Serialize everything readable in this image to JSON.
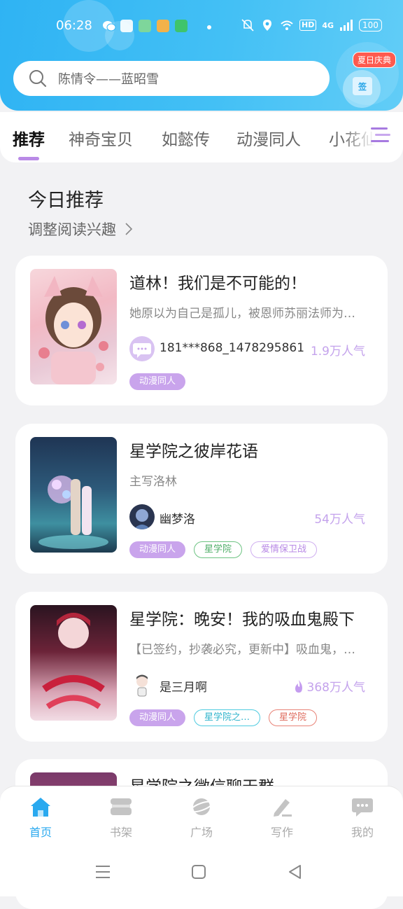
{
  "status_bar": {
    "time": "06:28",
    "hd": "HD",
    "network": "4G",
    "battery": "100"
  },
  "search": {
    "placeholder": "陈情令——蓝昭雪"
  },
  "sign_in": {
    "badge": "夏日庆典",
    "icon_text": "签"
  },
  "tabs": [
    {
      "label": "推荐",
      "active": true
    },
    {
      "label": "神奇宝贝",
      "active": false
    },
    {
      "label": "如懿传",
      "active": false
    },
    {
      "label": "动漫同人",
      "active": false
    },
    {
      "label": "小花仙",
      "active": false
    }
  ],
  "section": {
    "title": "今日推荐",
    "subtitle": "调整阅读兴趣"
  },
  "books": [
    {
      "title": "道林！我们是不可能的！",
      "desc": "她原以为自己是孤儿，被恩师苏丽法师为…",
      "author": "181***868_1478295861",
      "popularity": "1.9万人气",
      "tags": [
        "动漫同人"
      ]
    },
    {
      "title": "星学院之彼岸花语",
      "desc": "主写洛林",
      "author": "幽梦洛",
      "popularity": "54万人气",
      "tags": [
        "动漫同人",
        "星学院",
        "爱情保卫战"
      ]
    },
    {
      "title": "星学院：晚安！我的吸血鬼殿下",
      "desc": "【已签约，抄袭必究，更新中】吸血鬼，…",
      "author": "是三月啊",
      "popularity": "368万人气",
      "tags": [
        "动漫同人",
        "星学院之…",
        "星学院"
      ]
    },
    {
      "title": "星学院之微信聊天群"
    }
  ],
  "bottom_nav": [
    {
      "label": "首页",
      "icon": "home-icon",
      "active": true
    },
    {
      "label": "书架",
      "icon": "bookshelf-icon",
      "active": false
    },
    {
      "label": "广场",
      "icon": "planet-icon",
      "active": false
    },
    {
      "label": "写作",
      "icon": "pen-icon",
      "active": false
    },
    {
      "label": "我的",
      "icon": "chat-bubble-icon",
      "active": false
    }
  ],
  "colors": {
    "header": "#36b6f4",
    "accent_purple": "#b98ae6",
    "nav_active": "#2aa9ef"
  }
}
